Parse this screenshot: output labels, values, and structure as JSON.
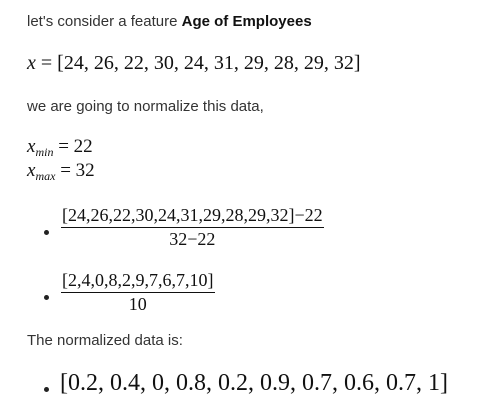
{
  "intro": {
    "prefix": "let's consider a feature ",
    "feature": "Age of Employees"
  },
  "x_equation": {
    "var": "x",
    "eq": " = ",
    "values": "[24, 26, 22, 30, 24, 31, 29, 28, 29, 32]"
  },
  "normalize_text": "we are going to normalize this data,",
  "xmin": {
    "var": "x",
    "sub": "min",
    "eq": " = 22"
  },
  "xmax": {
    "var": "x",
    "sub": "max",
    "eq": " = 32"
  },
  "step1": {
    "numerator": "[24,26,22,30,24,31,29,28,29,32]−22",
    "denominator": "32−22"
  },
  "step2": {
    "numerator": "[2,4,0,8,2,9,7,6,7,10]",
    "denominator": "10"
  },
  "normalized_label": "The normalized data is:",
  "result": "[0.2, 0.4, 0, 0.8, 0.2, 0.9, 0.7, 0.6, 0.7, 1]"
}
